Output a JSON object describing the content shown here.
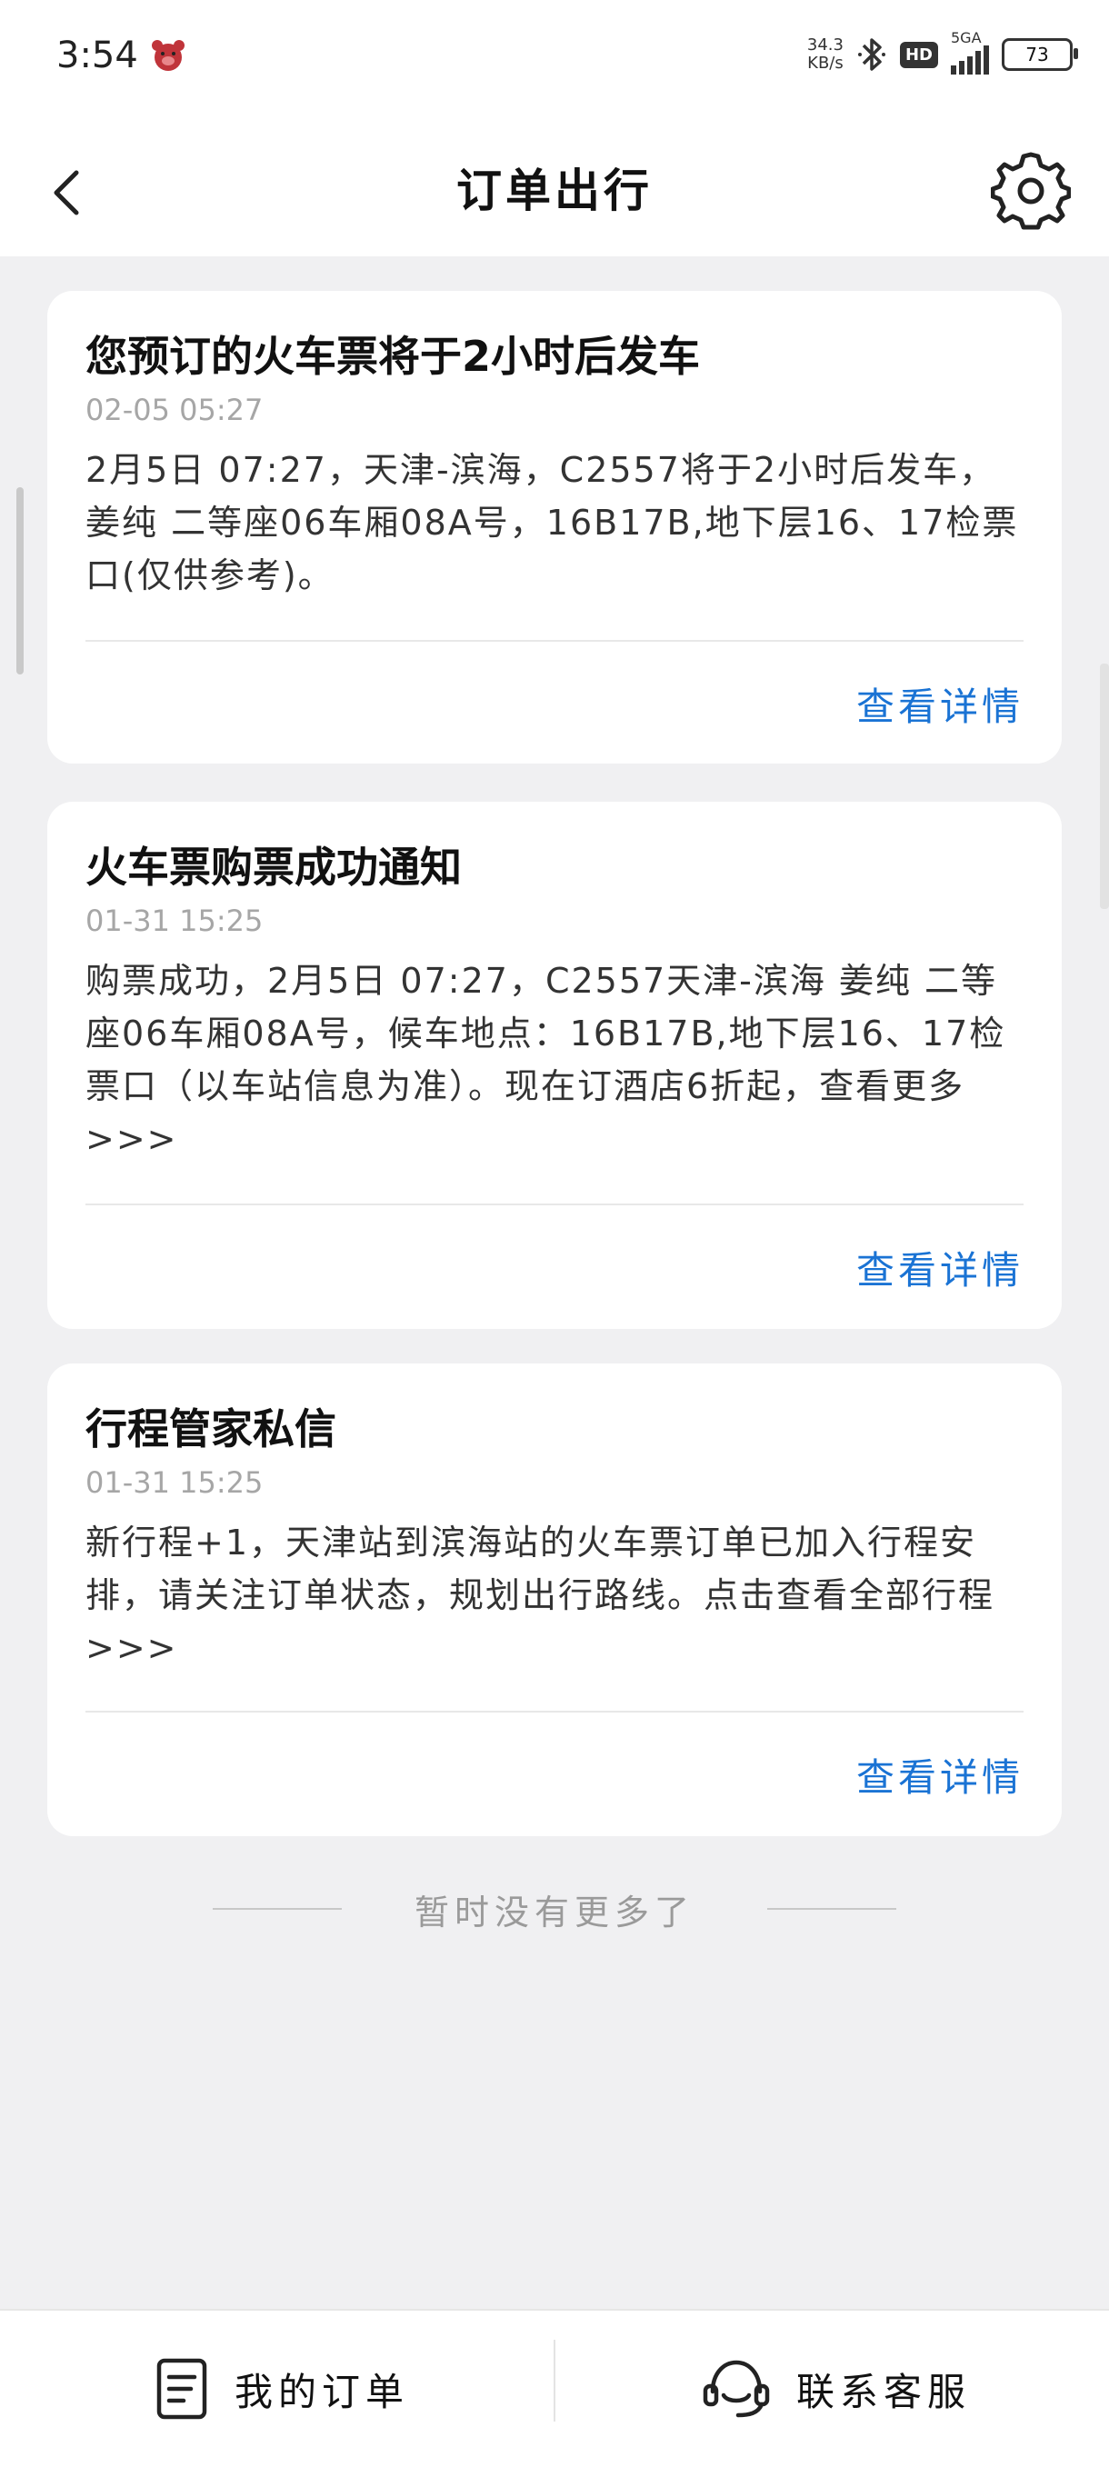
{
  "status_bar": {
    "time": "3:54",
    "net_speed_value": "34.3",
    "net_speed_unit": "KB/s",
    "hd": "HD",
    "network": "5GA",
    "battery": "73"
  },
  "header": {
    "title": "订单出行",
    "back_icon": "chevron-left-icon",
    "settings_icon": "gear-icon"
  },
  "cards": [
    {
      "title": "您预订的火车票将于2小时后发车",
      "time": "02-05 05:27",
      "body": "2月5日 07:27，天津-滨海，C2557将于2小时后发车，姜纯 二等座06车厢08A号，16B17B,地下层16、17检票口(仅供参考)。",
      "link": "查看详情"
    },
    {
      "title": "火车票购票成功通知",
      "time": "01-31 15:25",
      "body": "购票成功，2月5日 07:27，C2557天津-滨海 姜纯 二等座06车厢08A号，候车地点：16B17B,地下层16、17检票口（以车站信息为准）。现在订酒店6折起，查看更多>>>",
      "link": "查看详情"
    },
    {
      "title": "行程管家私信",
      "time": "01-31 15:25",
      "body": "新行程+1，天津站到滨海站的火车票订单已加入行程安排，请关注订单状态，规划出行路线。点击查看全部行程 >>>",
      "link": "查看详情"
    }
  ],
  "footer_note": "暂时没有更多了",
  "bottom_bar": {
    "orders_label": "我的订单",
    "orders_icon": "document-icon",
    "support_label": "联系客服",
    "support_icon": "headset-icon"
  },
  "colors": {
    "accent": "#1a73d4",
    "background": "#f0f0f2",
    "card": "#ffffff"
  }
}
